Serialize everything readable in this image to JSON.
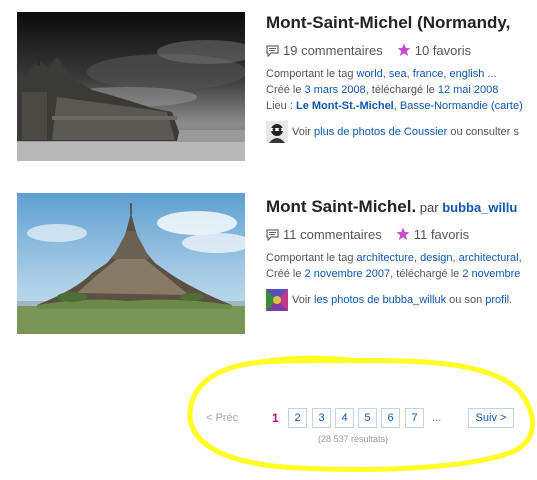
{
  "results": [
    {
      "title": "Mont-Saint-Michel (Normandy,",
      "comments": "19 commentaires",
      "favorites": "10 favoris",
      "tags_prefix": "Comportant le tag ",
      "tags": [
        "world",
        "sea",
        "france",
        "english ..."
      ],
      "created_prefix": "Créé le ",
      "created": "3 mars 2008",
      "uploaded_prefix": ", téléchargé le ",
      "uploaded": "12 mai 2008",
      "place_prefix": "Lieu : ",
      "place": "Le Mont-St.-Michel",
      "place_region": ", Basse-Normandie",
      "place_map": " (carte)",
      "more_prefix": "Voir ",
      "more_link": "plus de photos de Coussier",
      "more_suffix": " ou consulter s"
    },
    {
      "title": "Mont Saint-Michel.",
      "by_label": " par ",
      "author": "bubba_willu",
      "comments": "11 commentaires",
      "favorites": "11 favoris",
      "tags_prefix": "Comportant le tag ",
      "tags": [
        "architecture",
        "design",
        "architectural,"
      ],
      "created_prefix": "Créé le ",
      "created": "2 novembre 2007",
      "uploaded_prefix": ", téléchargé le ",
      "uploaded": "2 novembre",
      "more_prefix": "Voir ",
      "more_link": "les photos de bubba_willuk",
      "more_middle": " ou son ",
      "more_link2": "profil",
      "more_suffix": "."
    }
  ],
  "pagination": {
    "prev": "< Préc",
    "current": "1",
    "pages": [
      "2",
      "3",
      "4",
      "5",
      "6",
      "7"
    ],
    "ellipsis": "...",
    "next": "Suiv >",
    "result_count": "(28 537 résultats)"
  },
  "colors": {
    "link": "#1057ae",
    "current_page": "#d4007a",
    "highlight": "#ffff22",
    "favorite_star": "#c24bd0"
  }
}
